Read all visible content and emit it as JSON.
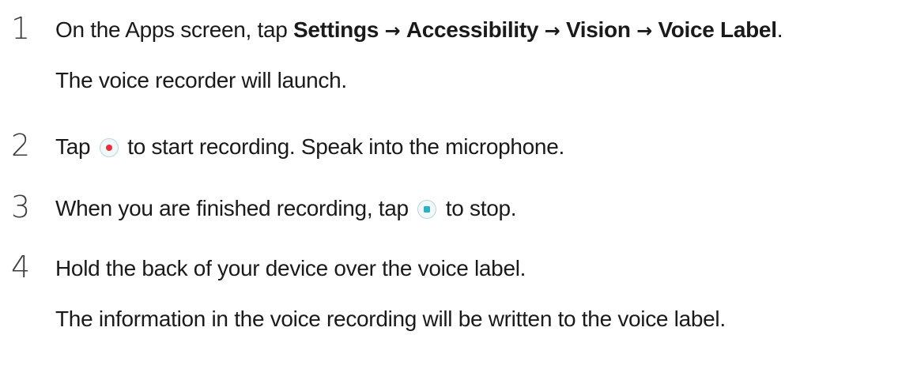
{
  "steps": [
    {
      "number": "1",
      "line1": {
        "prefix": "On the Apps screen, tap ",
        "settings": "Settings",
        "arrow1": "→",
        "accessibility": "Accessibility",
        "arrow2": "→",
        "vision": "Vision",
        "arrow3": "→",
        "voice_label": "Voice Label",
        "end": "."
      },
      "line2": "The voice recorder will launch."
    },
    {
      "number": "2",
      "before": "Tap",
      "after": "to start recording. Speak into the microphone.",
      "icon": "record-button-icon"
    },
    {
      "number": "3",
      "before": "When you are finished recording, tap",
      "after": "to stop.",
      "icon": "stop-button-icon"
    },
    {
      "number": "4",
      "line1": "Hold the back of your device over the voice label.",
      "line2": "The information in the voice recording will be written to the voice label."
    }
  ],
  "colors": {
    "record_dot": "#e8303b",
    "stop_square": "#2bb1c4",
    "text": "#1a1a1a"
  }
}
